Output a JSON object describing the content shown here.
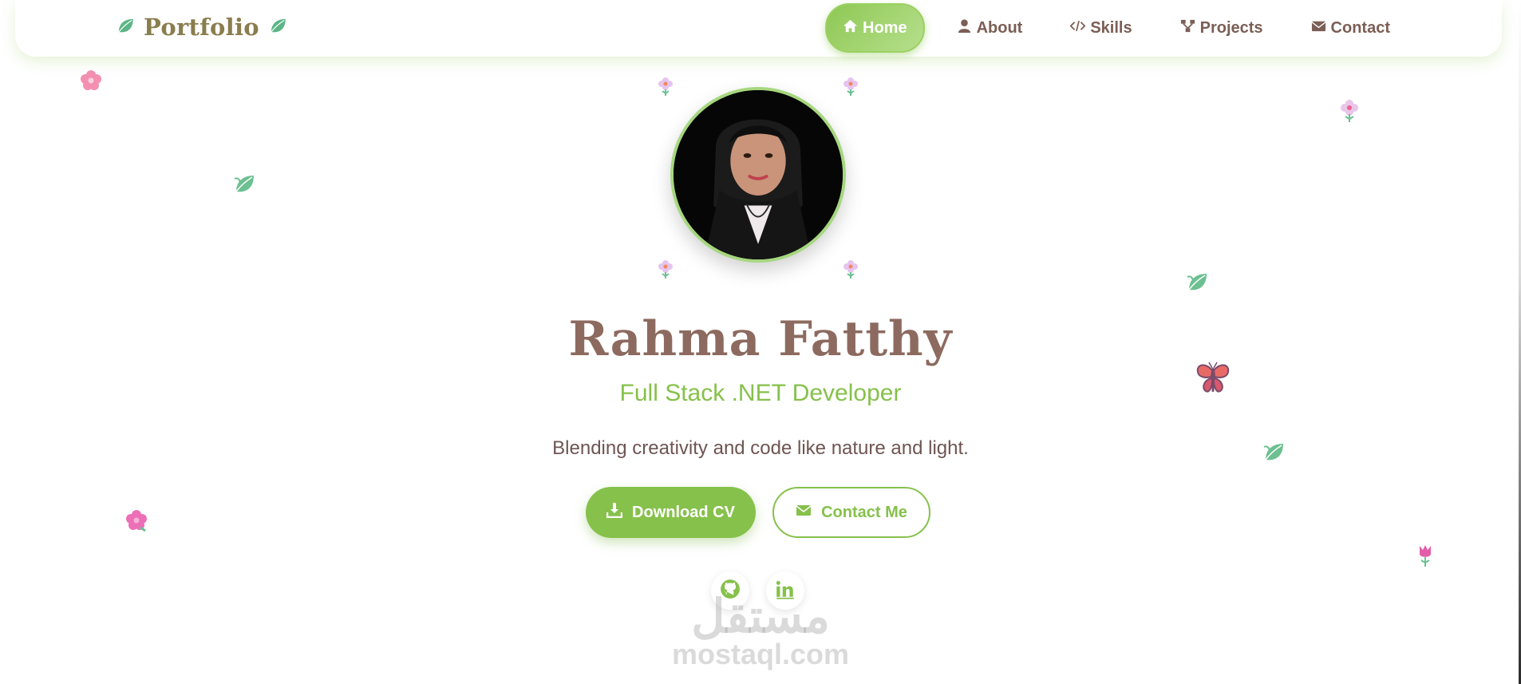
{
  "brand": {
    "name": "Portfolio"
  },
  "nav": {
    "items": [
      {
        "label": "Home",
        "icon": "home-icon",
        "active": true
      },
      {
        "label": "About",
        "icon": "user-icon",
        "active": false
      },
      {
        "label": "Skills",
        "icon": "code-icon",
        "active": false
      },
      {
        "label": "Projects",
        "icon": "projects-icon",
        "active": false
      },
      {
        "label": "Contact",
        "icon": "envelope-icon",
        "active": false
      }
    ]
  },
  "hero": {
    "name": "Rahma Fatthy",
    "role": "Full Stack .NET Developer",
    "tagline": "Blending creativity and code like nature and light.",
    "download_label": "Download CV",
    "contact_label": "Contact Me"
  },
  "social": [
    {
      "icon": "github-icon"
    },
    {
      "icon": "linkedin-icon"
    }
  ],
  "watermark": {
    "arabic": "مستقل",
    "latin": "mostaql.com"
  },
  "colors": {
    "accent": "#86c14b",
    "heading": "#8d6a5f",
    "nav_text": "#7b5e55",
    "brand": "#8a7d4e"
  }
}
